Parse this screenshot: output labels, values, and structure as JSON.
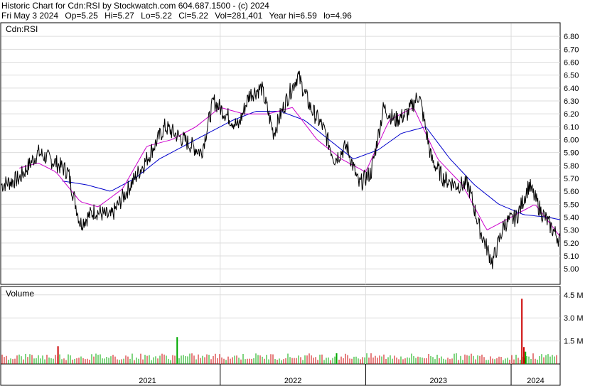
{
  "header": {
    "line1": "Historic Chart for Cdn:RSI by Stockwatch.com 604.687.1500 - (c) 2024",
    "date": "Fri May  3 2024",
    "open": "Op=5.25",
    "high": "Hi=5.27",
    "low": "Lo=5.22",
    "close": "Cl=5.22",
    "volume": "Vol=281,401",
    "year_hi": "Year hi=6.59",
    "year_lo": "lo=4.96"
  },
  "chart_data": {
    "type": "line",
    "symbol_label": "Cdn:RSI",
    "volume_label": "Volume",
    "price_axis": {
      "ylim": [
        4.88,
        6.9
      ],
      "ticks": [
        5.0,
        5.1,
        5.2,
        5.3,
        5.4,
        5.5,
        5.6,
        5.7,
        5.8,
        5.9,
        6.0,
        6.1,
        6.2,
        6.3,
        6.4,
        6.5,
        6.6,
        6.7,
        6.8
      ],
      "tick_labels": [
        "5.00",
        "5.10",
        "5.20",
        "5.30",
        "5.40",
        "5.50",
        "5.60",
        "5.70",
        "5.80",
        "5.90",
        "6.00",
        "6.10",
        "6.20",
        "6.30",
        "6.40",
        "6.50",
        "6.60",
        "6.70",
        "6.80"
      ]
    },
    "volume_axis": {
      "ylim": [
        0,
        5000000
      ],
      "ticks": [
        1500000,
        3000000,
        4500000
      ],
      "tick_labels": [
        "1.5 M",
        "3.0 M",
        "4.5 M"
      ]
    },
    "x_axis": {
      "labels": [
        "2021",
        "2022",
        "2023",
        "2024"
      ],
      "year_starts": [
        "2021-01-01",
        "2022-01-01",
        "2023-01-01",
        "2024-01-01"
      ],
      "range": [
        "2020-07-01",
        "2024-05-03"
      ]
    },
    "grid": true,
    "series": [
      {
        "role": "price",
        "color": "#000000",
        "x": [
          "2020-07-01",
          "2020-08-15",
          "2020-10-01",
          "2020-11-15",
          "2020-12-15",
          "2021-01-15",
          "2021-02-20",
          "2021-04-01",
          "2021-05-15",
          "2021-07-01",
          "2021-08-15",
          "2021-10-01",
          "2021-11-15",
          "2021-12-15",
          "2022-01-15",
          "2022-02-15",
          "2022-03-15",
          "2022-04-15",
          "2022-05-15",
          "2022-06-15",
          "2022-07-15",
          "2022-08-15",
          "2022-09-15",
          "2022-10-15",
          "2022-11-15",
          "2022-12-15",
          "2023-01-15",
          "2023-02-15",
          "2023-03-15",
          "2023-04-15",
          "2023-05-15",
          "2023-06-15",
          "2023-07-15",
          "2023-08-15",
          "2023-09-15",
          "2023-10-15",
          "2023-11-15",
          "2023-12-15",
          "2024-01-15",
          "2024-02-15",
          "2024-03-15",
          "2024-04-15",
          "2024-05-03"
        ],
        "values": [
          5.65,
          5.7,
          5.9,
          5.82,
          5.75,
          5.35,
          5.45,
          5.4,
          5.62,
          5.85,
          6.1,
          6.0,
          5.9,
          6.3,
          6.2,
          6.1,
          6.35,
          6.4,
          6.05,
          6.3,
          6.5,
          6.25,
          6.1,
          5.85,
          5.95,
          5.65,
          5.75,
          6.25,
          6.15,
          6.2,
          6.35,
          5.85,
          5.7,
          5.65,
          5.65,
          5.3,
          5.05,
          5.35,
          5.4,
          5.65,
          5.45,
          5.3,
          5.22
        ]
      },
      {
        "role": "short_ma",
        "color": "#cc00cc",
        "x": [
          "2020-08-15",
          "2020-10-01",
          "2020-11-15",
          "2021-01-15",
          "2021-03-01",
          "2021-05-01",
          "2021-07-01",
          "2021-09-01",
          "2021-11-01",
          "2022-01-01",
          "2022-03-01",
          "2022-05-01",
          "2022-07-01",
          "2022-09-01",
          "2022-11-01",
          "2023-01-01",
          "2023-03-01",
          "2023-05-01",
          "2023-07-01",
          "2023-09-01",
          "2023-11-01",
          "2024-01-01",
          "2024-03-01",
          "2024-05-03"
        ],
        "values": [
          5.78,
          5.82,
          5.75,
          5.52,
          5.48,
          5.62,
          5.95,
          6.0,
          6.1,
          6.25,
          6.2,
          6.2,
          6.25,
          6.0,
          5.85,
          5.75,
          6.15,
          6.25,
          5.85,
          5.65,
          5.3,
          5.4,
          5.5,
          5.25
        ]
      },
      {
        "role": "long_ma",
        "color": "#0000cc",
        "x": [
          "2020-12-01",
          "2021-02-01",
          "2021-04-01",
          "2021-06-01",
          "2021-08-01",
          "2021-10-01",
          "2021-12-01",
          "2022-02-01",
          "2022-04-01",
          "2022-06-01",
          "2022-08-01",
          "2022-10-01",
          "2022-12-01",
          "2023-02-01",
          "2023-04-01",
          "2023-06-01",
          "2023-08-01",
          "2023-10-01",
          "2023-12-01",
          "2024-02-01",
          "2024-04-01",
          "2024-05-03"
        ],
        "values": [
          5.68,
          5.65,
          5.6,
          5.7,
          5.85,
          5.95,
          6.05,
          6.15,
          6.22,
          6.22,
          6.15,
          6.0,
          5.85,
          5.92,
          6.05,
          6.1,
          5.85,
          5.65,
          5.5,
          5.42,
          5.4,
          5.38
        ]
      }
    ],
    "volume_spikes": [
      {
        "x": "2020-11-20",
        "value": 1150000,
        "color": "#cc0000"
      },
      {
        "x": "2021-09-15",
        "value": 1750000,
        "color": "#00aa00"
      },
      {
        "x": "2022-10-20",
        "value": 700000,
        "color": "#00aa00"
      },
      {
        "x": "2024-01-28",
        "value": 4250000,
        "color": "#cc0000"
      },
      {
        "x": "2024-02-02",
        "value": 1100000,
        "color": "#cc0000"
      },
      {
        "x": "2024-02-06",
        "value": 800000,
        "color": "#00aa00"
      }
    ]
  },
  "colors": {
    "up_volume": "#00aa00",
    "down_volume": "#cc0000",
    "grid": "#dddddd"
  }
}
